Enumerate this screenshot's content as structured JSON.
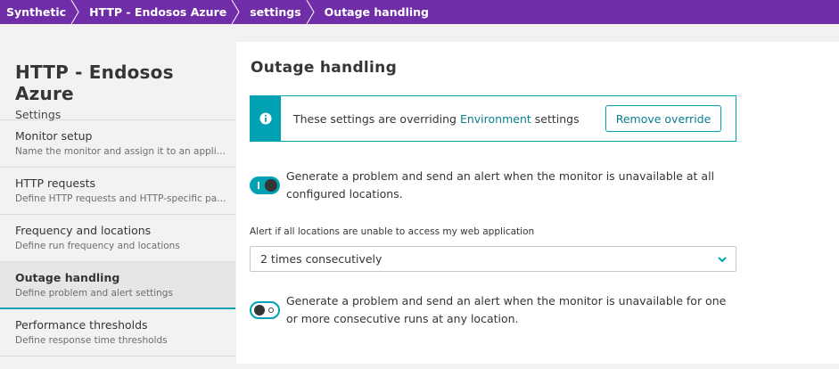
{
  "breadcrumb": [
    "Synthetic",
    "HTTP - Endosos Azure",
    "settings",
    "Outage handling"
  ],
  "sidebar": {
    "title": "HTTP - Endosos Azure",
    "subtitle": "Settings",
    "items": [
      {
        "label": "Monitor setup",
        "desc": "Name the monitor and assign it to an application"
      },
      {
        "label": "HTTP requests",
        "desc": "Define HTTP requests and HTTP-specific parameters"
      },
      {
        "label": "Frequency and locations",
        "desc": "Define run frequency and locations"
      },
      {
        "label": "Outage handling",
        "desc": "Define problem and alert settings",
        "active": true
      },
      {
        "label": "Performance thresholds",
        "desc": "Define response time thresholds"
      }
    ]
  },
  "main": {
    "title": "Outage handling",
    "info": {
      "text_before": "These settings are overriding ",
      "link": "Environment",
      "text_after": " settings",
      "button": "Remove override"
    },
    "toggle1": {
      "text": "Generate a problem and send an alert when the monitor is unavailable at all configured locations.",
      "on": true
    },
    "alert_label": "Alert if all locations are unable to access my web application",
    "alert_select": "2 times consecutively",
    "toggle2": {
      "text": "Generate a problem and send an alert when the monitor is unavailable for one or more consecutive runs at any location.",
      "on": false
    }
  },
  "colors": {
    "breadcrumb_bg": "#6f2da8",
    "accent": "#00a1b2"
  },
  "icons": [
    "info-icon",
    "chevron-down-icon",
    "breadcrumb-separator-icon"
  ]
}
